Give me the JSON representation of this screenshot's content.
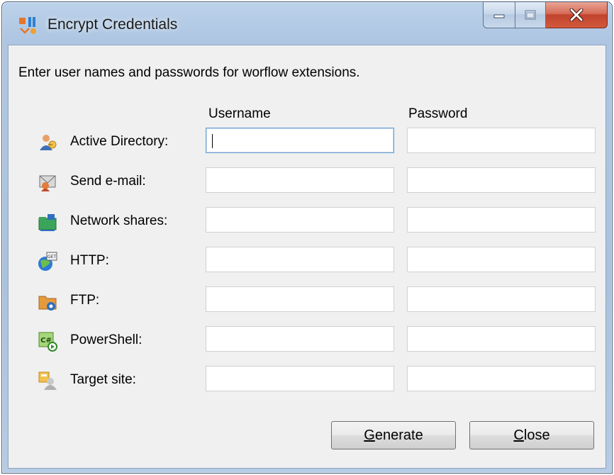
{
  "window": {
    "title": "Encrypt Credentials",
    "controls": {
      "minimize_icon": "minimize-icon",
      "maximize_icon": "maximize-icon",
      "close_icon": "close-icon"
    }
  },
  "form": {
    "instruction": "Enter user names and passwords for worflow extensions.",
    "headers": {
      "username": "Username",
      "password": "Password"
    },
    "rows": [
      {
        "label": "Active Directory:",
        "icon": "active-directory-icon",
        "username": "",
        "password": ""
      },
      {
        "label": "Send e-mail:",
        "icon": "email-icon",
        "username": "",
        "password": ""
      },
      {
        "label": "Network shares:",
        "icon": "network-share-icon",
        "username": "",
        "password": ""
      },
      {
        "label": "HTTP:",
        "icon": "http-icon",
        "username": "",
        "password": ""
      },
      {
        "label": "FTP:",
        "icon": "ftp-icon",
        "username": "",
        "password": ""
      },
      {
        "label": "PowerShell:",
        "icon": "powershell-icon",
        "username": "",
        "password": ""
      },
      {
        "label": "Target site:",
        "icon": "target-site-icon",
        "username": "",
        "password": ""
      }
    ]
  },
  "buttons": {
    "generate": {
      "mnemonic": "G",
      "rest": "enerate"
    },
    "close": {
      "mnemonic": "C",
      "rest": "lose"
    }
  }
}
